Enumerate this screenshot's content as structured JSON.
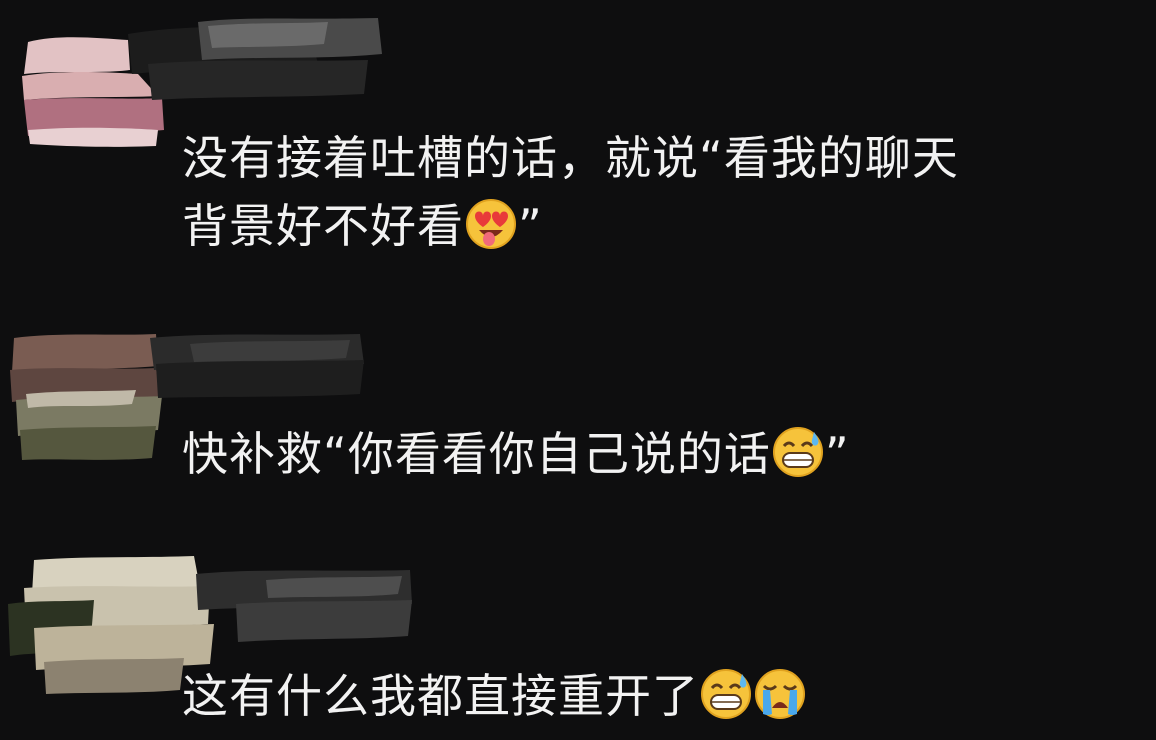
{
  "comments": [
    {
      "line1": "没有接着吐槽的话，就说“看我的聊天",
      "line2_text": "背景好不好看",
      "line2_emoji": "heart-eyes-tongue-emoji",
      "line2_close": "”"
    },
    {
      "line1_text": "快补救“你看看你自己说的话",
      "line1_emoji": "grinning-sweat-emoji",
      "line1_close": "”"
    },
    {
      "line1_text": "这有什么我都直接重开了",
      "emojis": [
        "grinning-sweat-emoji",
        "loudly-crying-emoji"
      ]
    }
  ]
}
